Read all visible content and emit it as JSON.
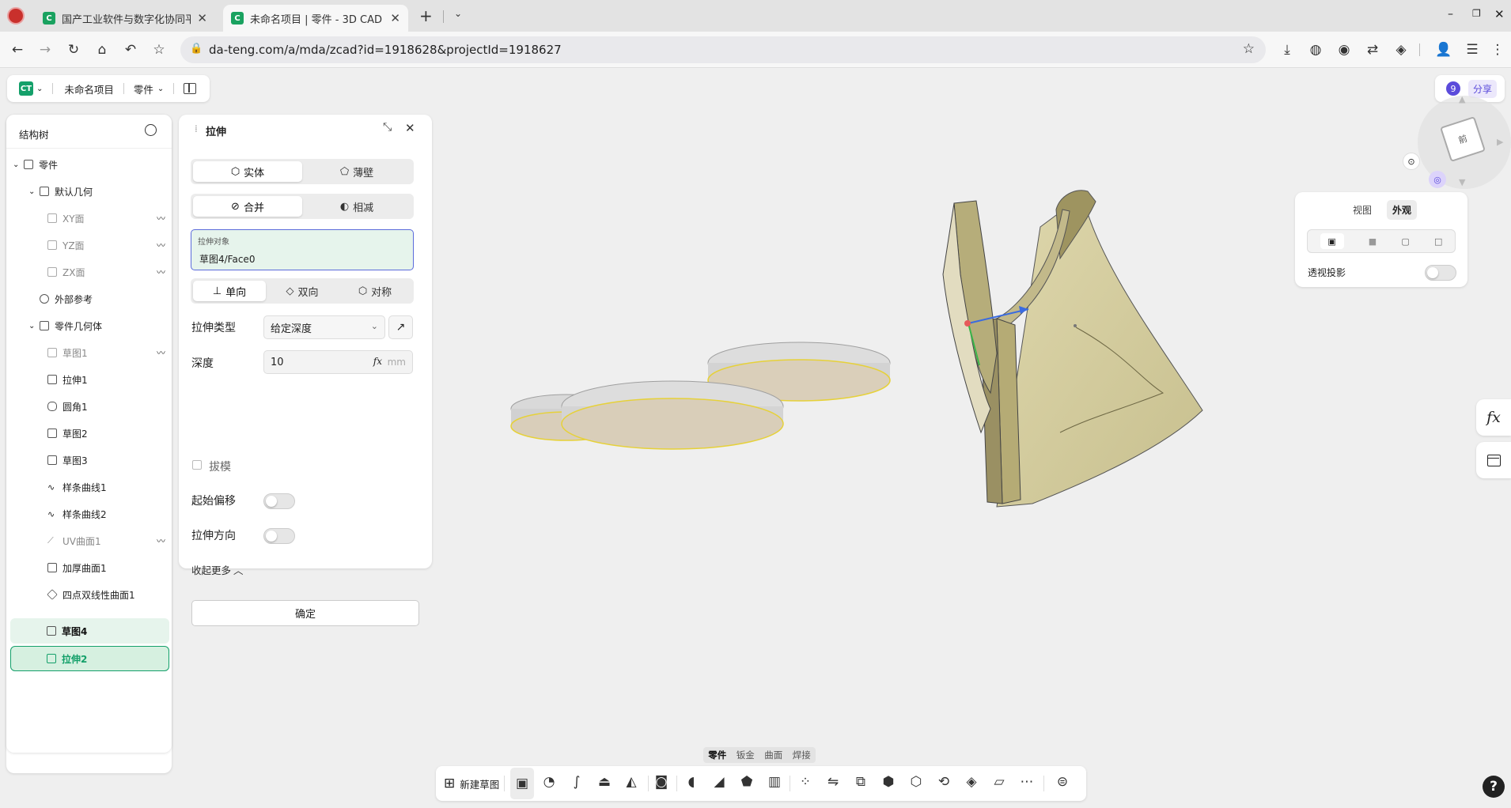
{
  "browser": {
    "tabs": [
      {
        "title": "国产工业软件与数字化协同平"
      },
      {
        "title": "未命名项目 | 零件 - 3D CAD"
      }
    ],
    "url": "da-teng.com/a/mda/zcad?id=1918628&projectId=1918627"
  },
  "app": {
    "logo": "CT",
    "project_name": "未命名项目",
    "doc_type": "零件",
    "badge_count": "9",
    "share_label": "分享"
  },
  "tree": {
    "title": "结构树",
    "items": [
      {
        "label": "零件"
      },
      {
        "label": "默认几何"
      },
      {
        "label": "XY面"
      },
      {
        "label": "YZ面"
      },
      {
        "label": "ZX面"
      },
      {
        "label": "外部参考"
      },
      {
        "label": "零件几何体"
      },
      {
        "label": "草图1"
      },
      {
        "label": "拉伸1"
      },
      {
        "label": "圆角1"
      },
      {
        "label": "草图2"
      },
      {
        "label": "草图3"
      },
      {
        "label": "样条曲线1"
      },
      {
        "label": "样条曲线2"
      },
      {
        "label": "UV曲面1"
      },
      {
        "label": "加厚曲面1"
      },
      {
        "label": "四点双线性曲面1"
      },
      {
        "label": "草图4"
      },
      {
        "label": "拉伸2"
      }
    ]
  },
  "extrude": {
    "title": "拉伸",
    "body_solid": "实体",
    "body_thin": "薄壁",
    "op_merge": "合并",
    "op_subtract": "相减",
    "target_label": "拉伸对象",
    "target_value": "草图4/Face0",
    "dir_single": "单向",
    "dir_double": "双向",
    "dir_symmetric": "对称",
    "type_label": "拉伸类型",
    "type_value": "给定深度",
    "depth_label": "深度",
    "depth_value": "10",
    "depth_fx": "fx",
    "depth_unit": "mm",
    "draft_label": "拔模",
    "offset_label": "起始偏移",
    "direction_label": "拉伸方向",
    "collapse_label": "收起更多",
    "confirm_label": "确定"
  },
  "view_panel": {
    "tab_view": "视图",
    "tab_appearance": "外观",
    "perspective_label": "透视投影"
  },
  "viewcube": {
    "face_label": "前"
  },
  "right_tools": {
    "fx": "fx"
  },
  "bottom": {
    "tabs": [
      "零件",
      "钣金",
      "曲面",
      "焊接"
    ],
    "new_sketch": "新建草图"
  },
  "colors": {
    "accent": "#14a06a",
    "accent_bg": "#e2f3ea",
    "model": "#c8c08c"
  }
}
